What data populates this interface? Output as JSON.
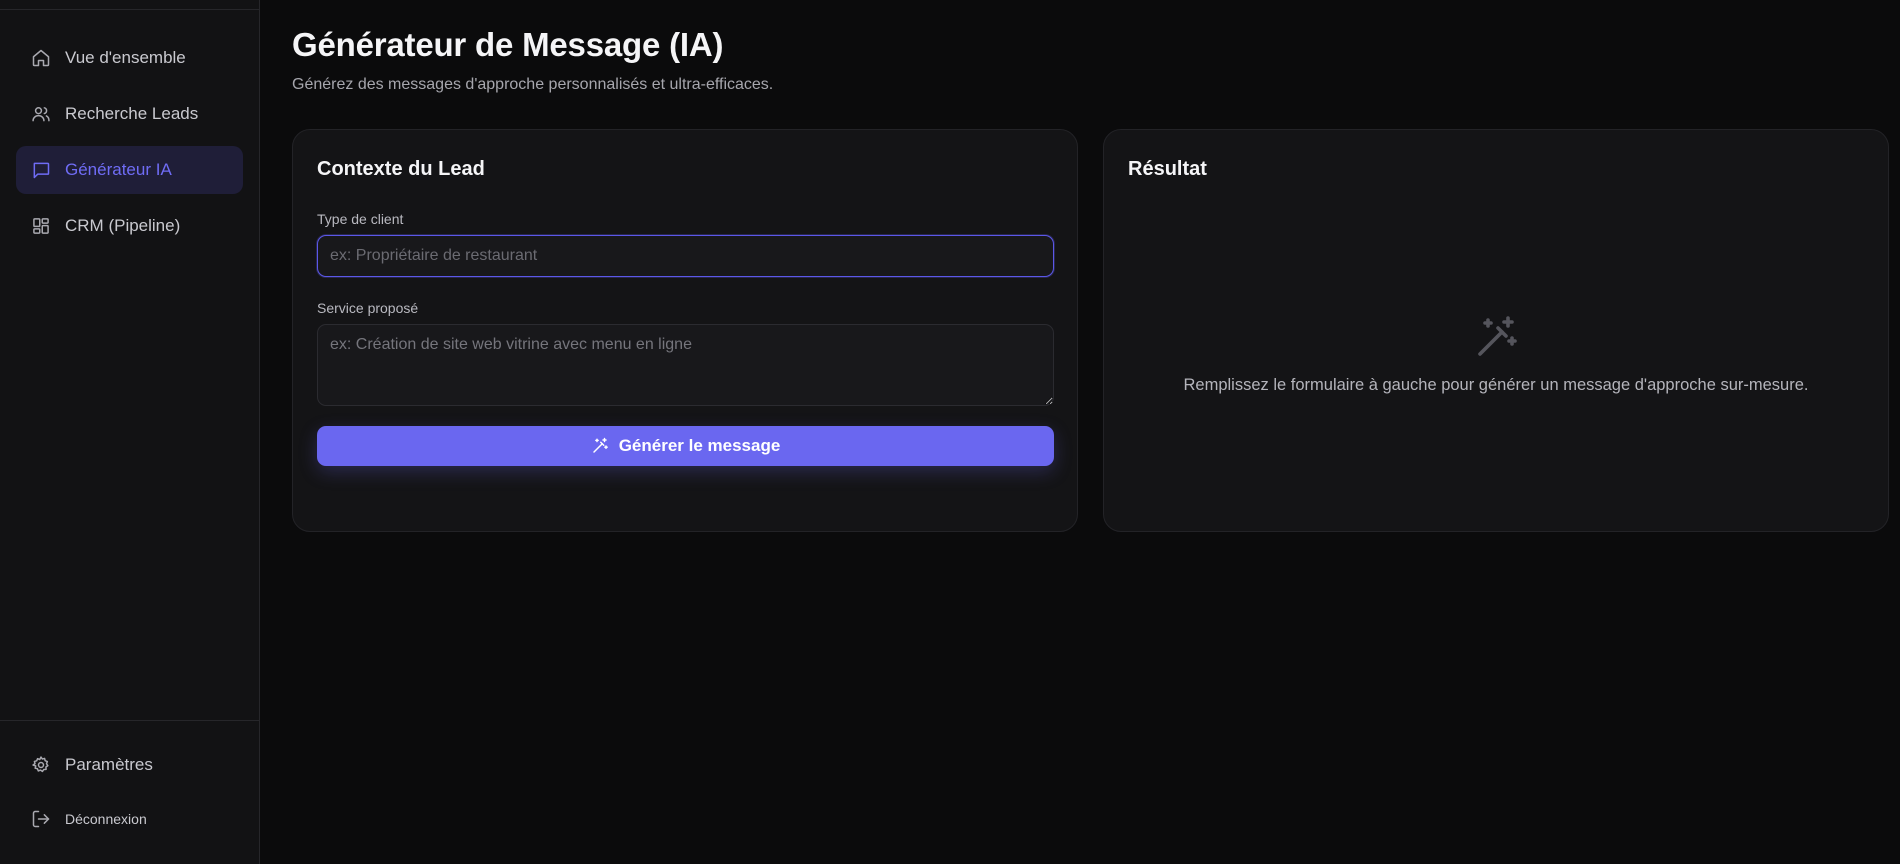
{
  "sidebar": {
    "items": [
      {
        "label": "Vue d'ensemble",
        "icon": "home-icon",
        "active": false
      },
      {
        "label": "Recherche Leads",
        "icon": "users-icon",
        "active": false
      },
      {
        "label": "Générateur IA",
        "icon": "message-square-icon",
        "active": true
      },
      {
        "label": "CRM (Pipeline)",
        "icon": "layout-grid-icon",
        "active": false
      }
    ],
    "settings_label": "Paramètres",
    "logout_label": "Déconnexion"
  },
  "header": {
    "title": "Générateur de Message (IA)",
    "subtitle": "Générez des messages d'approche personnalisés et ultra-efficaces."
  },
  "form": {
    "title": "Contexte du Lead",
    "client_type_label": "Type de client",
    "client_type_placeholder": "ex: Propriétaire de restaurant",
    "client_type_value": "",
    "service_label": "Service proposé",
    "service_placeholder": "ex: Création de site web vitrine avec menu en ligne",
    "service_value": "",
    "generate_label": "Générer le message"
  },
  "result": {
    "title": "Résultat",
    "empty_text": "Remplissez le formulaire à gauche pour générer un message d'approche sur-mesure.",
    "empty_icon": "magic-wand-icon"
  },
  "colors": {
    "accent": "#6a67f0",
    "active_bg": "#1f1e38",
    "background": "#0b0b0c",
    "card": "#141416"
  }
}
